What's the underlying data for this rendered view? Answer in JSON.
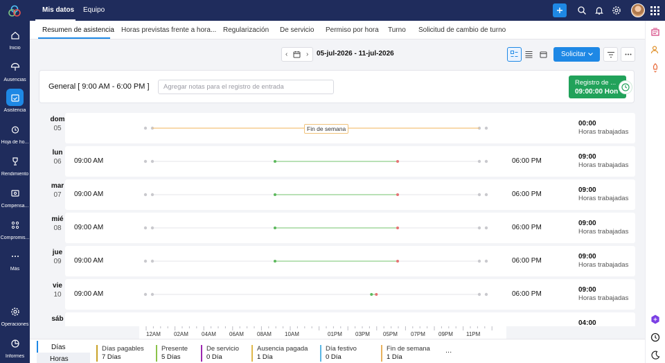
{
  "topbar": {
    "tabs": [
      {
        "label": "Mis datos",
        "active": true
      },
      {
        "label": "Equipo",
        "active": false
      }
    ],
    "icons": [
      "plus-icon",
      "search-icon",
      "bell-icon",
      "gear-icon",
      "avatar",
      "grid-icon"
    ]
  },
  "leftnav": {
    "items": [
      {
        "label": "Inicio",
        "icon": "home-icon",
        "active": false
      },
      {
        "label": "Ausencias",
        "icon": "umbrella-icon",
        "active": false
      },
      {
        "label": "Asistencia",
        "icon": "calendar-check-icon",
        "active": true
      },
      {
        "label": "Hoja de ho...",
        "icon": "timesheet-icon",
        "active": false
      },
      {
        "label": "Rendimiento",
        "icon": "trophy-icon",
        "active": false
      },
      {
        "label": "Compensa...",
        "icon": "compensation-icon",
        "active": false
      },
      {
        "label": "Compromis...",
        "icon": "engagement-icon",
        "active": false
      },
      {
        "label": "Más",
        "icon": "more-icon",
        "active": false
      },
      {
        "label": "Operaciones",
        "icon": "operations-icon",
        "active": false
      },
      {
        "label": "Informes",
        "icon": "reports-icon",
        "active": false
      }
    ]
  },
  "subtabs": [
    {
      "label": "Resumen de asistencia",
      "active": true
    },
    {
      "label": "Horas previstas frente a hora...",
      "active": false
    },
    {
      "label": "Regularización",
      "active": false
    },
    {
      "label": "De servicio",
      "active": false
    },
    {
      "label": "Permiso por hora",
      "active": false
    },
    {
      "label": "Turno",
      "active": false
    },
    {
      "label": "Solicitud de cambio de turno",
      "active": false
    }
  ],
  "toolbar": {
    "date_range": "05-jul-2026  -  11-jul-2026",
    "request_label": "Solicitar"
  },
  "general": {
    "title": "General [ 9:00 AM - 6:00 PM ]",
    "notes_placeholder": "Agregar notas para el registro de entrada",
    "checkin_line1": "Registro de ...",
    "checkin_line2": "09:00:00 Hon"
  },
  "days": [
    {
      "day": "dom",
      "num": "05",
      "in": "",
      "out": "",
      "hours": "00:00",
      "hours_label": "Horas trabajadas",
      "weekend": true,
      "weekend_label": "Fin de semana",
      "seg": [
        0,
        1
      ]
    },
    {
      "day": "lun",
      "num": "06",
      "in": "09:00 AM",
      "out": "06:00 PM",
      "hours": "09:00",
      "hours_label": "Horas trabajadas",
      "seg": [
        0.375,
        0.75
      ]
    },
    {
      "day": "mar",
      "num": "07",
      "in": "09:00 AM",
      "out": "06:00 PM",
      "hours": "09:00",
      "hours_label": "Horas trabajadas",
      "seg": [
        0.375,
        0.75
      ]
    },
    {
      "day": "mié",
      "num": "08",
      "in": "09:00 AM",
      "out": "06:00 PM",
      "hours": "09:00",
      "hours_label": "Horas trabajadas",
      "seg": [
        0.375,
        0.75
      ]
    },
    {
      "day": "jue",
      "num": "09",
      "in": "09:00 AM",
      "out": "06:00 PM",
      "hours": "09:00",
      "hours_label": "Horas trabajadas",
      "seg": [
        0.375,
        0.75
      ]
    },
    {
      "day": "vie",
      "num": "10",
      "in": "09:00 AM",
      "out": "06:00 PM",
      "hours": "09:00",
      "hours_label": "Horas trabajadas",
      "seg": [
        0.67,
        0.685
      ]
    },
    {
      "day": "sáb",
      "num": "",
      "in": "",
      "out": "",
      "hours": "04:00",
      "hours_label": "",
      "weekend": true,
      "seg": null
    }
  ],
  "axis": [
    "12AM",
    "02AM",
    "04AM",
    "06AM",
    "08AM",
    "10AM",
    "01PM",
    "03PM",
    "05PM",
    "07PM",
    "09PM",
    "11PM"
  ],
  "bottom": {
    "tabs": [
      {
        "label": "Días",
        "active": true
      },
      {
        "label": "Horas",
        "active": false
      }
    ],
    "stats": [
      {
        "label": "Días pagables",
        "value": "7 Días",
        "color": "#c9a227"
      },
      {
        "label": "Presente",
        "value": "5 Días",
        "color": "#8bc34a"
      },
      {
        "label": "De servicio",
        "value": "0 Día",
        "color": "#9c27b0"
      },
      {
        "label": "Ausencia pagada",
        "value": "1 Día",
        "color": "#e0b84a"
      },
      {
        "label": "Día festivo",
        "value": "0 Día",
        "color": "#5bb7e5"
      },
      {
        "label": "Fin de semana",
        "value": "1 Día",
        "color": "#e8b15c"
      }
    ],
    "more": "..."
  }
}
